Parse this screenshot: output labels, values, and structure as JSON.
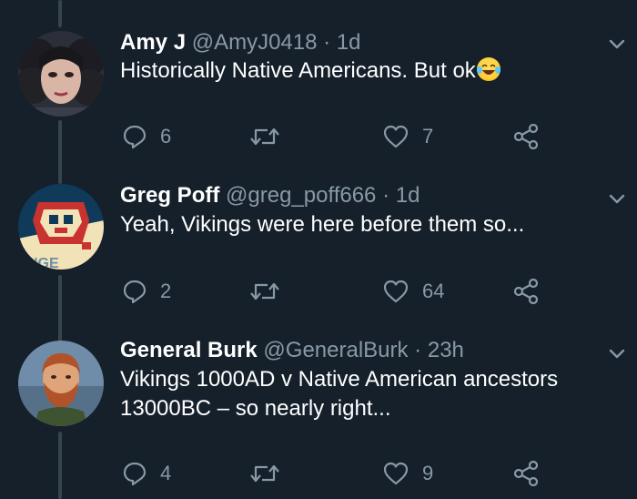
{
  "tweets": [
    {
      "name": "Amy J",
      "handle": "@AmyJ0418",
      "dot": "·",
      "time": "1d",
      "text": "Historically Native Americans. But ok",
      "emoji": "face-with-tears-of-joy",
      "replies": "6",
      "retweets": "",
      "likes": "7"
    },
    {
      "name": "Greg Poff",
      "handle": "@greg_poff666",
      "dot": "·",
      "time": "1d",
      "text": "Yeah, Vikings were here before them so...",
      "avatar_text": "NGE",
      "replies": "2",
      "retweets": "",
      "likes": "64"
    },
    {
      "name": "General Burk",
      "handle": "@GeneralBurk",
      "dot": "·",
      "time": "23h",
      "text_line1": "Vikings 1000AD v Native American ancestors",
      "text_line2": "13000BC – so nearly right...",
      "replies": "4",
      "retweets": "",
      "likes": "9"
    }
  ],
  "colors": {
    "background": "#15202b",
    "secondary_text": "#8899a6",
    "thread_line": "#38444d"
  }
}
